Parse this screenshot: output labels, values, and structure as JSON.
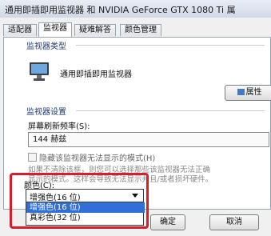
{
  "window": {
    "title": "通用即插即用监视器 和 NVIDIA GeForce GTX 1080 Ti 属"
  },
  "tabs": [
    {
      "label": "适配器"
    },
    {
      "label": "监视器"
    },
    {
      "label": "疑难解答"
    },
    {
      "label": "颜色管理"
    }
  ],
  "monitor_type": {
    "group_label": "监视器类型",
    "name": "通用即插即用监视器",
    "properties_button": "属性",
    "icon": "monitor-icon"
  },
  "monitor_settings": {
    "group_label": "监视器设置",
    "refresh_label": "屏幕刷新频率(S):",
    "refresh_value": "144 赫兹",
    "hide_modes_label": "隐藏该监视器无法显示的模式(H)",
    "hide_modes_checked": false,
    "desc_line1": "如果不清除该框，则您可以选择那些该监视器无法正确",
    "desc_line2": "显示的模式。这样会导致无法显示并且/或者损坏硬件。"
  },
  "colors": {
    "label": "颜色(C):",
    "selected": "增强色(16 位)",
    "options": [
      "增强色(16 位)",
      "真彩色(32 位)"
    ],
    "highlighted_index": 0
  },
  "footer": {
    "ok_button": "确定",
    "cancel_button": "取消"
  },
  "accent": {
    "highlight_frame": "#d51f2a",
    "selection": "#2f6fd6"
  }
}
